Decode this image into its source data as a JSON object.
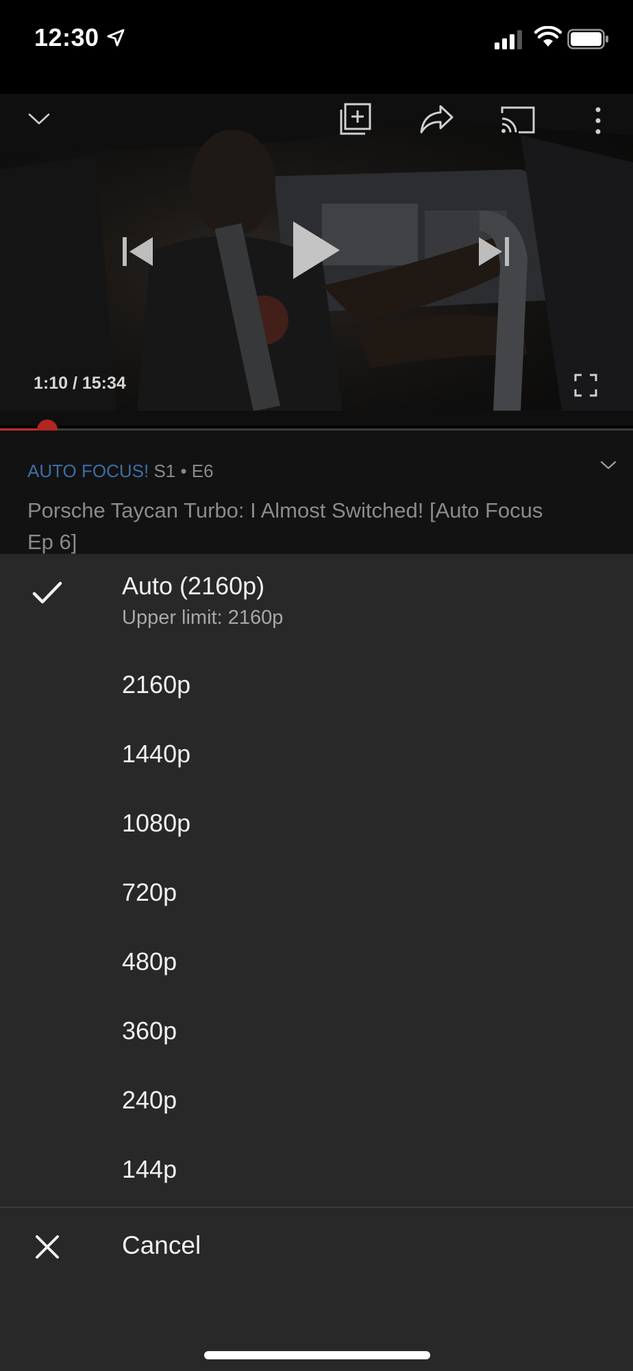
{
  "status_bar": {
    "time": "12:30"
  },
  "player": {
    "current_time": "1:10",
    "duration": "15:34",
    "time_display": "1:10 / 15:34",
    "progress_fraction": 0.075,
    "icons": [
      "chevron-down-icon",
      "add-to-queue-icon",
      "share-icon",
      "cast-icon",
      "more-vert-icon",
      "skip-previous-icon",
      "play-icon",
      "skip-next-icon",
      "fullscreen-icon"
    ]
  },
  "info": {
    "series_name": "AUTO FOCUS!",
    "episode": "S1 • E6",
    "title": "Porsche Taycan Turbo: I Almost Switched!  [Auto Focus Ep 6]"
  },
  "quality_menu": {
    "items": [
      {
        "label": "Auto (2160p)",
        "sublabel": "Upper limit: 2160p",
        "selected": true
      },
      {
        "label": "2160p",
        "selected": false
      },
      {
        "label": "1440p",
        "selected": false
      },
      {
        "label": "1080p",
        "selected": false
      },
      {
        "label": "720p",
        "selected": false
      },
      {
        "label": "480p",
        "selected": false
      },
      {
        "label": "360p",
        "selected": false
      },
      {
        "label": "240p",
        "selected": false
      },
      {
        "label": "144p",
        "selected": false
      }
    ],
    "cancel_label": "Cancel"
  },
  "colors": {
    "progress_red": "#c4302b",
    "series_blue": "#3d6ea8",
    "sheet_bg": "#282828"
  }
}
